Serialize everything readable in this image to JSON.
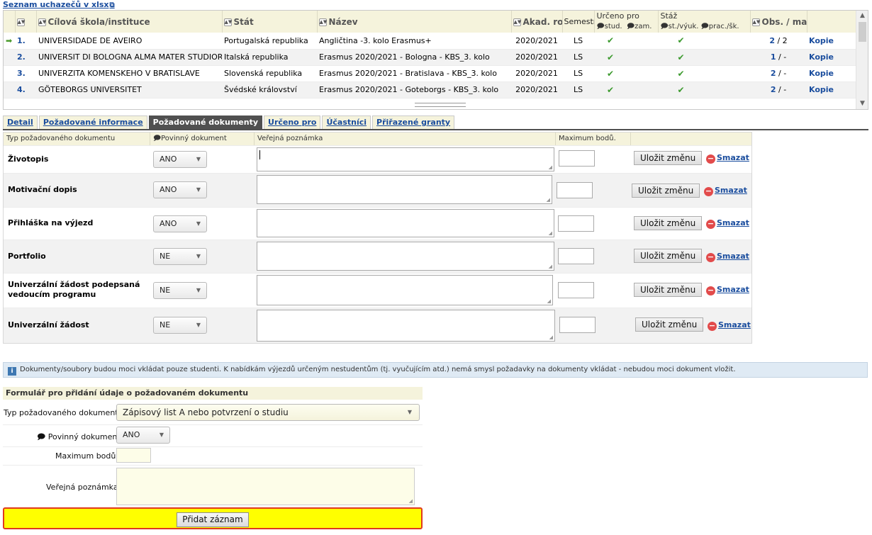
{
  "top_link": {
    "label": "Seznam uchazečů v xlsx",
    "icon": "external-link-icon"
  },
  "grid": {
    "headers": {
      "school": "Cílová škola/instituce",
      "country": "Stát",
      "name": "Název",
      "year": "Akad. rok",
      "semester": "Semestr",
      "intended": "Určeno pro",
      "intended_stud": "stud.",
      "intended_zam": "zam.",
      "internship": "Stáž",
      "intern_st": "st./výuk.",
      "intern_prac": "prac./šk.",
      "occupancy": "Obs. / max"
    },
    "rows": [
      {
        "idx": "1.",
        "school": "UNIVERSIDADE DE AVEIRO",
        "country": "Portugalská republika",
        "name": "Angličtina -3. kolo Erasmus+",
        "year": "2020/2021",
        "semester": "LS",
        "occ_a": "2",
        "occ_b": "/ 2",
        "copy": "Kopie"
      },
      {
        "idx": "2.",
        "school": "UNIVERSIT DI BOLOGNA ALMA MATER STUDIORUM",
        "country": "Italská republika",
        "name": "Erasmus 2020/2021 - Bologna - KBS_3. kolo",
        "year": "2020/2021",
        "semester": "LS",
        "occ_a": "1",
        "occ_b": "/ -",
        "copy": "Kopie"
      },
      {
        "idx": "3.",
        "school": "UNIVERZITA KOMENSKEHO V BRATISLAVE",
        "country": "Slovenská republika",
        "name": "Erasmus 2020/2021 - Bratislava - KBS_3. kolo",
        "year": "2020/2021",
        "semester": "LS",
        "occ_a": "2",
        "occ_b": "/ -",
        "copy": "Kopie"
      },
      {
        "idx": "4.",
        "school": "GÖTEBORGS UNIVERSITET",
        "country": "Švédské království",
        "name": "Erasmus 2020/2021 - Goteborgs - KBS_3. kolo",
        "year": "2020/2021",
        "semester": "LS",
        "occ_a": "2",
        "occ_b": "/ -",
        "copy": "Kopie"
      }
    ]
  },
  "tabs": [
    {
      "label": "Detail"
    },
    {
      "label": "Požadované informace"
    },
    {
      "label": "Požadované dokumenty"
    },
    {
      "label": "Určeno pro"
    },
    {
      "label": "Účastníci"
    },
    {
      "label": "Přiřazené granty"
    }
  ],
  "docs": {
    "headers": {
      "type": "Typ požadovaného dokumentu",
      "mandatory": "Povinný dokument",
      "note": "Veřejná poznámka",
      "max": "Maximum bodů."
    },
    "save_label": "Uložit změnu",
    "delete_label": "Smazat",
    "rows": [
      {
        "label": "Životopis",
        "mandatory": "ANO"
      },
      {
        "label": "Motivační dopis",
        "mandatory": "ANO"
      },
      {
        "label": "Přihláška na výjezd",
        "mandatory": "ANO"
      },
      {
        "label": "Portfolio",
        "mandatory": "NE"
      },
      {
        "label": "Univerzální žádost podepsaná vedoucím programu",
        "mandatory": "NE"
      },
      {
        "label": "Univerzální žádost",
        "mandatory": "NE"
      }
    ]
  },
  "info": {
    "text": "Dokumenty/soubory budou moci vkládat pouze studenti. K nabídkám výjezdů určeným nestudentům (tj. vyučujícím atd.) nemá smysl požadavky na dokumenty vkládat - nebudou moci dokument vložit."
  },
  "form": {
    "title": "Formulář pro přidání údaje o požadovaném dokumentu",
    "type_label": "Typ požadovaného dokumentu",
    "type_value": "Zápisový list A nebo potvrzení o studiu",
    "mandatory_label": "Povinný dokument",
    "mandatory_value": "ANO",
    "max_label": "Maximum bodů.",
    "note_label": "Veřejná poznámka",
    "submit_label": "Přidat záznam"
  }
}
